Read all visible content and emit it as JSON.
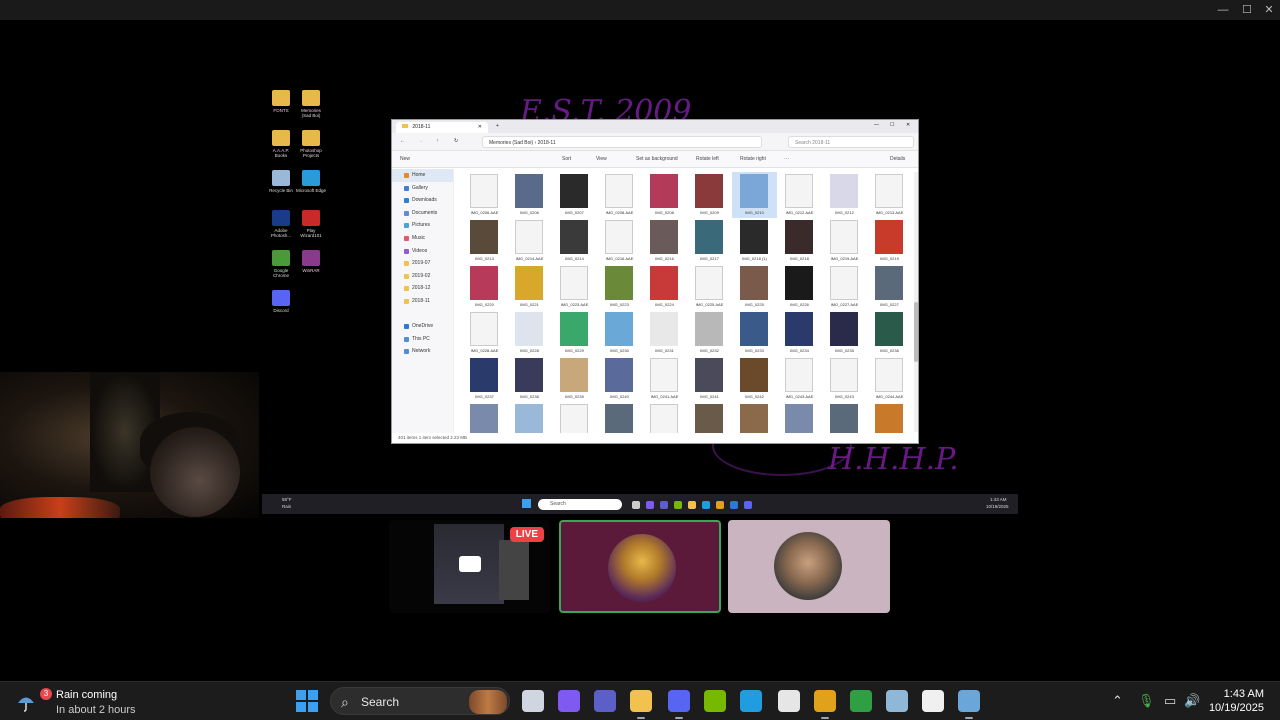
{
  "explorer": {
    "tab_title": "2018-11",
    "breadcrumb": [
      "Memories (Sad Boi)",
      "2018-11"
    ],
    "search_placeholder": "Search 2018-11",
    "toolbar": [
      "New",
      "Sort",
      "View",
      "Set as background",
      "Rotate left",
      "Rotate right",
      "Details"
    ],
    "nav": [
      {
        "label": "Home",
        "color": "#e58a2b",
        "selected": true
      },
      {
        "label": "Gallery",
        "color": "#3b7fd6"
      },
      {
        "label": "Downloads",
        "color": "#2d7fd1"
      },
      {
        "label": "Documents",
        "color": "#5f8bd9"
      },
      {
        "label": "Pictures",
        "color": "#4aa1e0"
      },
      {
        "label": "Music",
        "color": "#e6566e"
      },
      {
        "label": "Videos",
        "color": "#8a5fd6"
      },
      {
        "label": "2019-07",
        "color": "#f2c14e"
      },
      {
        "label": "2019-02",
        "color": "#f2c14e"
      },
      {
        "label": "2018-12",
        "color": "#f2c14e"
      },
      {
        "label": "2018-11",
        "color": "#f2c14e"
      },
      {
        "label": "",
        "color": "transparent"
      },
      {
        "label": "OneDrive",
        "color": "#2b78d6"
      },
      {
        "label": "This PC",
        "color": "#4d8fd9"
      },
      {
        "label": "Network",
        "color": "#4d8fd9"
      }
    ],
    "files": [
      {
        "name": "IMG_0206.AAE",
        "c": "#f4f4f4"
      },
      {
        "name": "IMG_0206",
        "c": "#5a6a8a"
      },
      {
        "name": "IMG_0207",
        "c": "#2a2a2a"
      },
      {
        "name": "IMG_0208.AAE",
        "c": "#f4f4f4"
      },
      {
        "name": "IMG_0208",
        "c": "#b43a5a"
      },
      {
        "name": "IMG_0209",
        "c": "#8a3a3a"
      },
      {
        "name": "IMG_0210",
        "c": "#7aa6d8",
        "sel": true
      },
      {
        "name": "IMG_0212.AAE",
        "c": "#f4f4f4"
      },
      {
        "name": "IMG_0212",
        "c": "#d8d8e8"
      },
      {
        "name": "IMG_0213.AAE",
        "c": "#f4f4f4"
      },
      {
        "name": "IMG_0213",
        "c": "#5a4a3a"
      },
      {
        "name": "IMG_0214.AAE",
        "c": "#f4f4f4"
      },
      {
        "name": "IMG_0214",
        "c": "#3a3a3a"
      },
      {
        "name": "IMG_0216.AAE",
        "c": "#f4f4f4"
      },
      {
        "name": "IMG_0216",
        "c": "#6a5a5a"
      },
      {
        "name": "IMG_0217",
        "c": "#3a6a7a"
      },
      {
        "name": "IMG_0218 (1)",
        "c": "#2a2a2a"
      },
      {
        "name": "IMG_0218",
        "c": "#3a2a2a"
      },
      {
        "name": "IMG_0219.AAE",
        "c": "#f4f4f4"
      },
      {
        "name": "IMG_0219",
        "c": "#c83a2a"
      },
      {
        "name": "IMG_0220",
        "c": "#b83a5a"
      },
      {
        "name": "IMG_0221",
        "c": "#d8a82a"
      },
      {
        "name": "IMG_0223.AAE",
        "c": "#f4f4f4"
      },
      {
        "name": "IMG_0223",
        "c": "#6a8a3a"
      },
      {
        "name": "IMG_0224",
        "c": "#c83a3a"
      },
      {
        "name": "IMG_0225.AAE",
        "c": "#f4f4f4"
      },
      {
        "name": "IMG_0225",
        "c": "#7a5a4a"
      },
      {
        "name": "IMG_0226",
        "c": "#1a1a1a"
      },
      {
        "name": "IMG_0227.AAE",
        "c": "#f4f4f4"
      },
      {
        "name": "IMG_0227",
        "c": "#5a6a7a"
      },
      {
        "name": "IMG_0228.AAE",
        "c": "#f4f4f4"
      },
      {
        "name": "IMG_0228",
        "c": "#dde4ee"
      },
      {
        "name": "IMG_0229",
        "c": "#3aa86a"
      },
      {
        "name": "IMG_0230",
        "c": "#6aa8d8"
      },
      {
        "name": "IMG_0231",
        "c": "#e8e8e8"
      },
      {
        "name": "IMG_0232",
        "c": "#b8b8b8"
      },
      {
        "name": "IMG_0233",
        "c": "#3a5a8a"
      },
      {
        "name": "IMG_0234",
        "c": "#2a3a6a"
      },
      {
        "name": "IMG_0235",
        "c": "#2a2a4a"
      },
      {
        "name": "IMG_0236",
        "c": "#2a5a4a"
      },
      {
        "name": "IMG_0237",
        "c": "#2a3a6a"
      },
      {
        "name": "IMG_0238",
        "c": "#3a3a5a"
      },
      {
        "name": "IMG_0239",
        "c": "#c8a87a"
      },
      {
        "name": "IMG_0240",
        "c": "#5a6a9a"
      },
      {
        "name": "IMG_0241.AAE",
        "c": "#f4f4f4"
      },
      {
        "name": "IMG_0241",
        "c": "#4a4a5a"
      },
      {
        "name": "IMG_0242",
        "c": "#6a4a2a"
      },
      {
        "name": "IMG_0243.AAE",
        "c": "#f4f4f4"
      },
      {
        "name": "IMG_0243",
        "c": "#f4f4f4"
      },
      {
        "name": "IMG_0244.AAE",
        "c": "#f4f4f4"
      },
      {
        "name": "IMG_0244",
        "c": "#7a8aaa"
      },
      {
        "name": "IMG_0245",
        "c": "#9ab8d8"
      },
      {
        "name": "IMG_0246.AAE",
        "c": "#f4f4f4"
      },
      {
        "name": "IMG_0246",
        "c": "#5a6a7a"
      },
      {
        "name": "IMG_0247.AAE",
        "c": "#f4f4f4"
      },
      {
        "name": "IMG_0247",
        "c": "#6a5a4a"
      },
      {
        "name": "IMG_0248",
        "c": "#8a6a4a"
      },
      {
        "name": "IMG_0249",
        "c": "#7a8aaa"
      },
      {
        "name": "IMG_0250",
        "c": "#5a6a7a"
      },
      {
        "name": "IMG_0251",
        "c": "#c87a2a"
      }
    ],
    "status": "401 items    1 item selected  2.23 MB"
  },
  "desktop_icons": [
    {
      "label": "FONTS",
      "color": "#e8b84a"
    },
    {
      "label": "Memories (Sad Boi)",
      "color": "#e8b84a"
    },
    {
      "label": "A.A.A.P. Books",
      "color": "#e8b84a"
    },
    {
      "label": "Photoshop Projects",
      "color": "#e8b84a"
    },
    {
      "label": "Recycle Bin",
      "color": "#9ab8d8"
    },
    {
      "label": "Microsoft Edge",
      "color": "#2a9ad8"
    },
    {
      "label": "Adobe Photosh...",
      "color": "#1a3a8a"
    },
    {
      "label": "Play Wizard101",
      "color": "#c82a2a"
    },
    {
      "label": "Google Chrome",
      "color": "#4a9a3a"
    },
    {
      "label": "WinRAR",
      "color": "#8a3a8a"
    },
    {
      "label": "Discord",
      "color": "#5865f2"
    }
  ],
  "wallpaper": {
    "top": "E.S.T. 2009",
    "bottom": "H.H.H.P."
  },
  "inner_taskbar": {
    "weather_temp": "58°F",
    "weather_cond": "Rain",
    "search": "Search",
    "time": "1:43 AM",
    "date": "10/19/2025"
  },
  "stream": {
    "live_badge": "LIVE"
  },
  "taskbar": {
    "weather_badge": "3",
    "weather_title": "Rain coming",
    "weather_sub": "In about 2 hours",
    "search": "Search",
    "time": "1:43 AM",
    "date": "10/19/2025",
    "apps": [
      {
        "name": "taskview-icon",
        "color": "#cfd6df"
      },
      {
        "name": "copilot-icon",
        "color": "#7f5af0"
      },
      {
        "name": "teams-icon",
        "color": "#5b5fc7"
      },
      {
        "name": "file-explorer-icon",
        "color": "#f2c14e"
      },
      {
        "name": "discord-icon",
        "color": "#5865f2"
      },
      {
        "name": "nvidia-icon",
        "color": "#76b900"
      },
      {
        "name": "edge-icon",
        "color": "#1f9de0"
      },
      {
        "name": "obs-icon",
        "color": "#e6e6e6"
      },
      {
        "name": "chrome-icon",
        "color": "#e0a21a"
      },
      {
        "name": "xbox-icon",
        "color": "#2ea043"
      },
      {
        "name": "steam-icon",
        "color": "#8fb8d8"
      },
      {
        "name": "gho-icon",
        "color": "#f0f0f0"
      },
      {
        "name": "steam-alt-icon",
        "color": "#6aa6d8"
      }
    ]
  }
}
